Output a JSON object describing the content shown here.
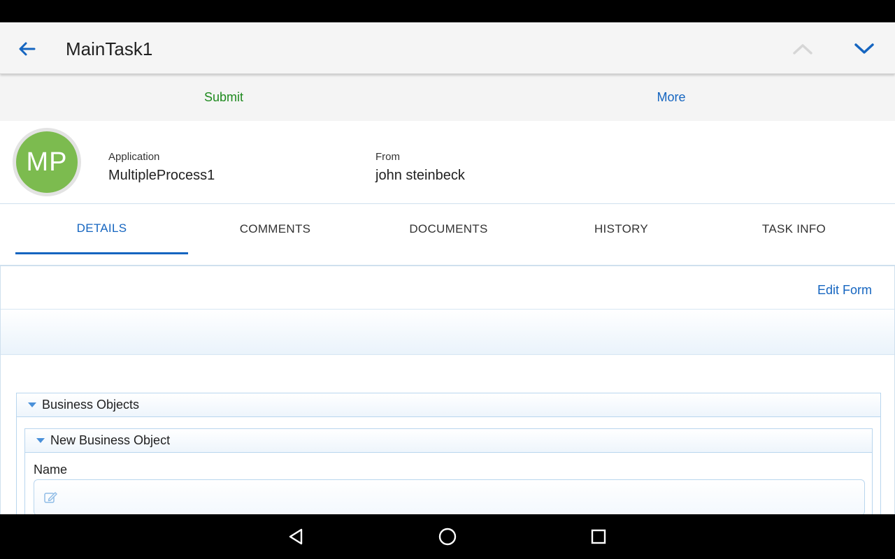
{
  "app_bar": {
    "title": "MainTask1",
    "back_icon": "arrow-left-icon",
    "prev_icon": "chevron-up-icon",
    "next_icon": "chevron-down-icon"
  },
  "actions": {
    "submit_label": "Submit",
    "more_label": "More"
  },
  "header": {
    "avatar_initials": "MP",
    "application_label": "Application",
    "application_value": "MultipleProcess1",
    "from_label": "From",
    "from_value": "john steinbeck"
  },
  "tabs": [
    {
      "label": "DETAILS",
      "active": true
    },
    {
      "label": "COMMENTS",
      "active": false
    },
    {
      "label": "DOCUMENTS",
      "active": false
    },
    {
      "label": "HISTORY",
      "active": false
    },
    {
      "label": "TASK INFO",
      "active": false
    }
  ],
  "form": {
    "edit_form_label": "Edit Form",
    "section_title": "Business Objects",
    "subsection_title": "New Business Object",
    "name_label": "Name",
    "name_value": ""
  },
  "colors": {
    "accent": "#1565c0",
    "submit": "#1f8a1f",
    "avatar": "#7cbb4f"
  }
}
